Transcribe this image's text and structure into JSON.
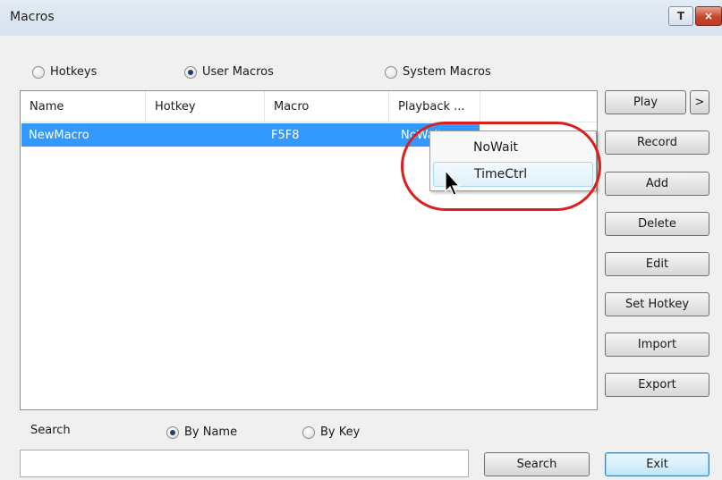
{
  "window": {
    "title": "Macros",
    "help_label": "T",
    "close_label": "×"
  },
  "macro_type": {
    "options": [
      {
        "label": "Hotkeys",
        "selected": false
      },
      {
        "label": "User Macros",
        "selected": true
      },
      {
        "label": "System Macros",
        "selected": false
      }
    ]
  },
  "table": {
    "columns": [
      "Name",
      "Hotkey",
      "Macro",
      "Playback ..."
    ],
    "rows": [
      {
        "name": "NewMacro",
        "hotkey": "",
        "macro": "F5F8",
        "playback": "NoWait"
      }
    ]
  },
  "context_menu": {
    "items": [
      "NoWait",
      "TimeCtrl"
    ],
    "hovered": "TimeCtrl"
  },
  "buttons": {
    "play": "Play",
    "play_more": ">",
    "record": "Record",
    "add": "Add",
    "delete": "Delete",
    "edit": "Edit",
    "set_hotkey": "Set Hotkey",
    "import": "Import",
    "export": "Export",
    "search": "Search",
    "exit": "Exit"
  },
  "search": {
    "label": "Search",
    "value": "",
    "by_options": [
      {
        "label": "By Name",
        "selected": true
      },
      {
        "label": "By Key",
        "selected": false
      }
    ]
  },
  "colors": {
    "selection": "#3399ff",
    "highlight_oval": "#d8211f",
    "close_button": "#c7452c"
  },
  "icons": {
    "cursor": "arrow-cursor-icon"
  }
}
